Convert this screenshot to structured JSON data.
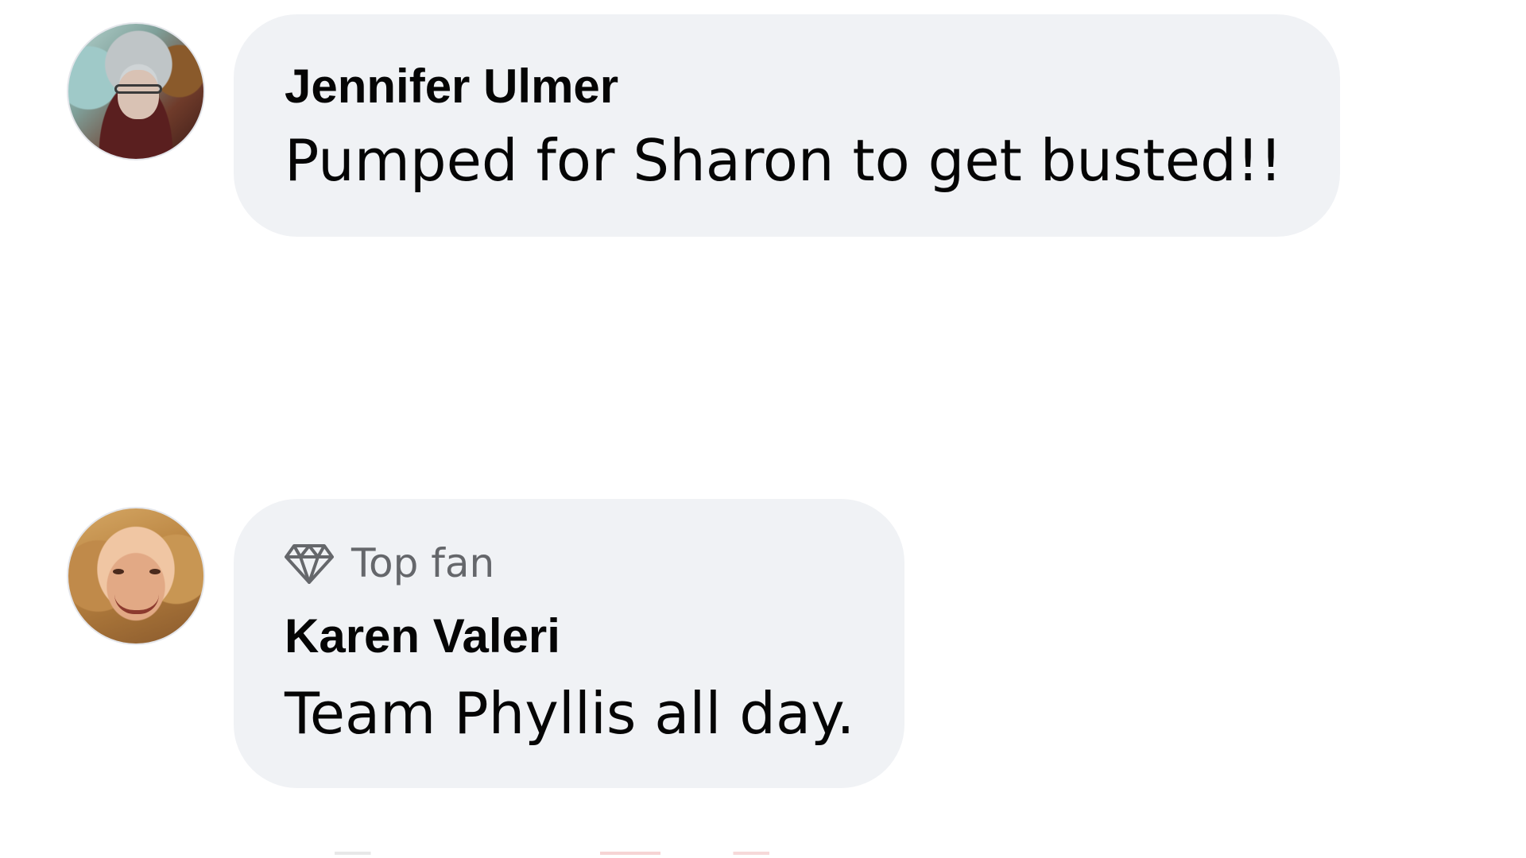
{
  "comments": [
    {
      "author": "Jennifer Ulmer",
      "text": "Pumped for Sharon to get busted!!"
    },
    {
      "badge": {
        "icon": "diamond-icon",
        "label": "Top fan"
      },
      "author": "Karen Valeri",
      "text": "Team Phyllis all day."
    }
  ],
  "colors": {
    "bubble_background": "#f0f2f5",
    "text_primary": "#050505",
    "text_secondary": "#65676b"
  }
}
